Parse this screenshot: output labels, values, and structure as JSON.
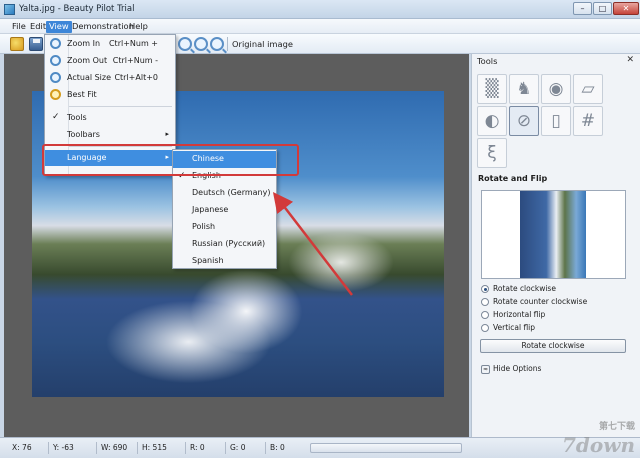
{
  "window": {
    "title": "Yalta.jpg - Beauty Pilot Trial",
    "buttons": {
      "minimize": "–",
      "maximize": "□",
      "close": "✕"
    }
  },
  "menubar": [
    "File",
    "Edit",
    "View",
    "Demonstration",
    "Help"
  ],
  "toolbar": {
    "original_label": "Original image"
  },
  "view_menu": {
    "zoom_in": {
      "label": "Zoom In",
      "shortcut": "Ctrl+Num +"
    },
    "zoom_out": {
      "label": "Zoom Out",
      "shortcut": "Ctrl+Num -"
    },
    "actual_size": {
      "label": "Actual Size",
      "shortcut": "Ctrl+Alt+0"
    },
    "best_fit": {
      "label": "Best Fit"
    },
    "tools": {
      "label": "Tools",
      "check": "✓"
    },
    "toolbars": {
      "label": "Toolbars",
      "arrow": "▸"
    },
    "language": {
      "label": "Language",
      "arrow": "▸"
    }
  },
  "language_menu": {
    "items": [
      "Chinese",
      "English",
      "Deutsch (Germany)",
      "Japanese",
      "Polish",
      "Russian (Русский)",
      "Spanish"
    ],
    "checked": "English",
    "check": "✓"
  },
  "panel": {
    "title": "Tools",
    "close": "✕",
    "section_title": "Rotate and Flip",
    "options": [
      "Rotate clockwise",
      "Rotate counter clockwise",
      "Horizontal flip",
      "Vertical flip"
    ],
    "selected_option": "Rotate clockwise",
    "action_label": "Rotate clockwise",
    "hide_label": "Hide Options",
    "hide_icon": "≈"
  },
  "status": {
    "x": "X: 76",
    "y": "Y: -63",
    "w": "W: 690",
    "h": "H: 515",
    "r": "R: 0",
    "g": "G: 0",
    "b": "B: 0"
  },
  "watermark": {
    "cn": "第七下载",
    "en": "7down"
  }
}
